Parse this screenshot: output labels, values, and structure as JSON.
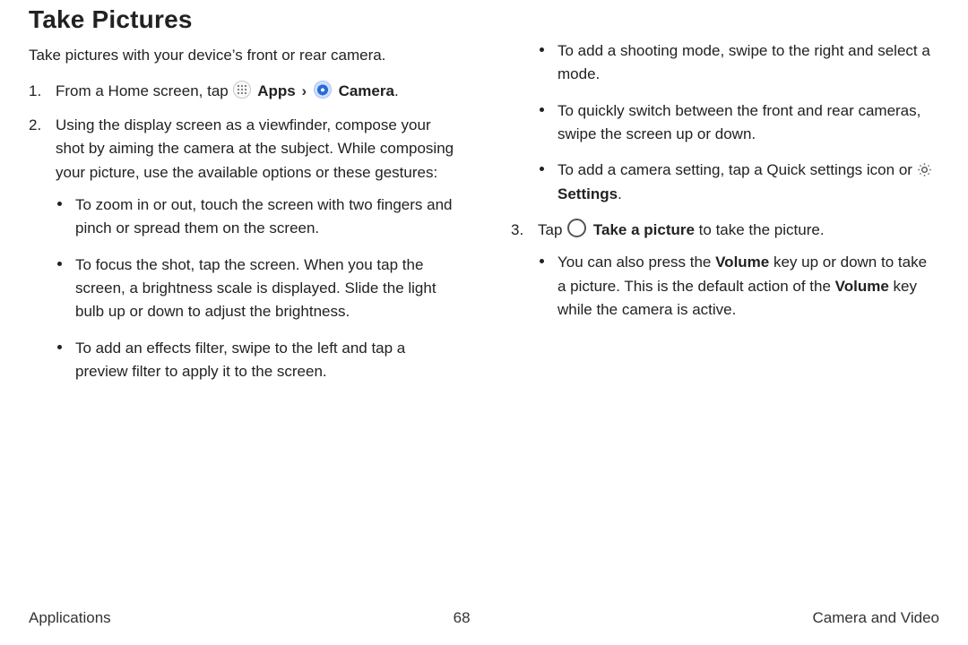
{
  "title": "Take Pictures",
  "intro": "Take pictures with your device’s front or rear camera.",
  "step1": {
    "pre": "From a Home screen, tap ",
    "apps": "Apps",
    "camera": "Camera",
    "post": "."
  },
  "step2": "Using the display screen as a viewfinder, compose your shot by aiming the camera at the subject. While composing your picture, use the available options or these gestures:",
  "s2a": "To zoom in or out, touch the screen with two fingers and pinch or spread them on the screen.",
  "s2b": "To focus the shot, tap the screen. When you tap the screen, a brightness scale is displayed. Slide the light bulb up or down to adjust the brightness.",
  "s2c": "To add an effects filter, swipe to the left and tap a preview filter to apply it to the screen.",
  "s2d": "To add a shooting mode, swipe to the right and select a mode.",
  "s2e": "To quickly switch between the front and rear cameras, swipe the screen up or down.",
  "s2f_pre": "To add a camera setting, tap a Quick settings icon or ",
  "s2f_settings": "Settings",
  "s2f_post": ".",
  "step3_pre": "Tap ",
  "step3_bold": "Take a picture",
  "step3_post": " to take the picture.",
  "s3a_pre": "You can also press the ",
  "s3a_vol1": "Volume",
  "s3a_mid": " key up or down to take a picture. This is the default action of the ",
  "s3a_vol2": "Volume",
  "s3a_post": " key while the camera is active.",
  "footer": {
    "left": "Applications",
    "center": "68",
    "right": "Camera and Video"
  }
}
